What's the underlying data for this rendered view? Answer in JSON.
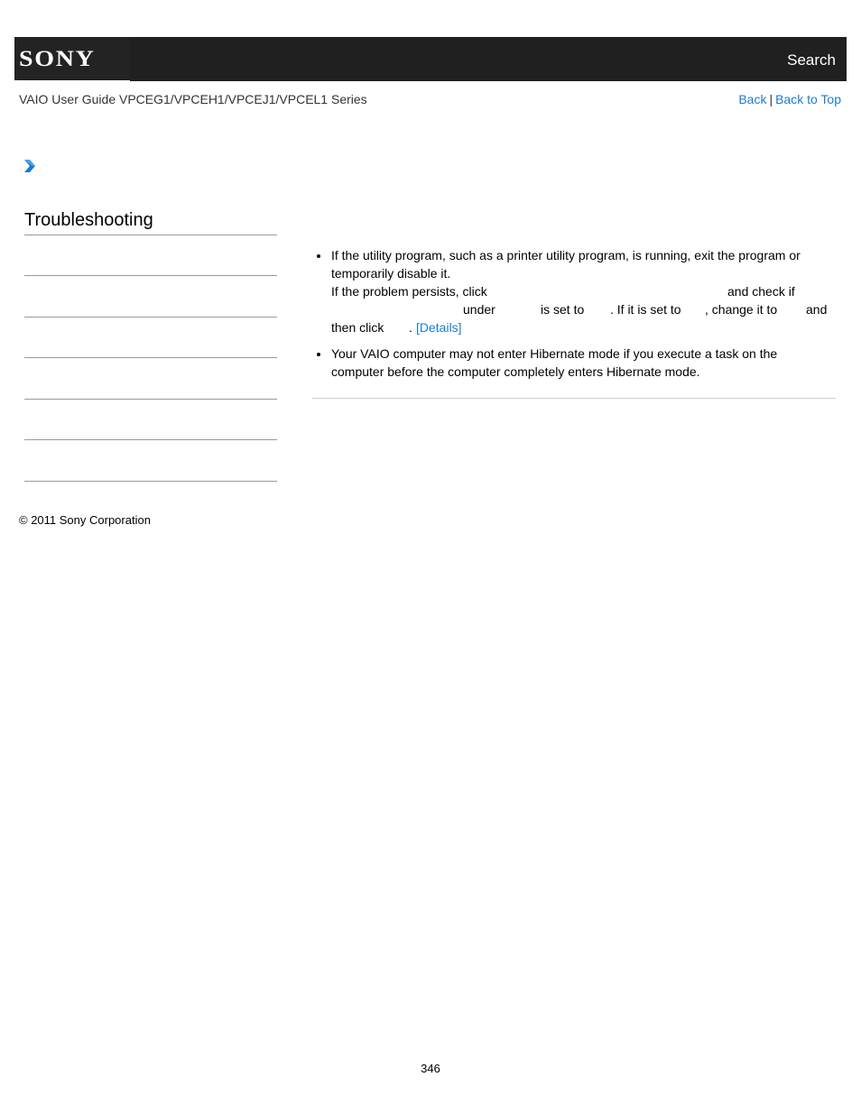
{
  "header": {
    "logo": "SONY",
    "search_label": "Search"
  },
  "guide": {
    "title": "VAIO User Guide VPCEG1/VPCEH1/VPCEJ1/VPCEL1 Series",
    "back_label": "Back",
    "separator": "|",
    "back_to_top_label": "Back to Top"
  },
  "breadcrumb": {
    "icon": "chevron-right-icon"
  },
  "sidebar": {
    "title": "Troubleshooting",
    "items": [
      "",
      "",
      "",
      "",
      "",
      ""
    ]
  },
  "content": {
    "bullets": [
      {
        "lines": [
          "If the utility program, such as a printer utility program, is running, exit the program or",
          "temporarily disable it."
        ],
        "para2": {
          "line1_a": "If the problem persists, click",
          "line1_b": "and check if",
          "line2_a": "under",
          "line2_b": "is set to",
          "line2_c": ". If it is set to",
          "line2_d": ", change it to",
          "line2_e": "and",
          "line3_a": "then click",
          "line3_b": ".",
          "details_link": "[Details]"
        }
      },
      {
        "lines": [
          "Your VAIO computer may not enter Hibernate mode if you execute a task on the",
          "computer before the computer completely enters Hibernate mode."
        ]
      }
    ]
  },
  "footer": {
    "copyright": "© 2011 Sony Corporation",
    "page_number": "346"
  },
  "colors": {
    "header_bg": "#202020",
    "link": "#1a7bd1",
    "chevron": "#1a7bd1"
  }
}
